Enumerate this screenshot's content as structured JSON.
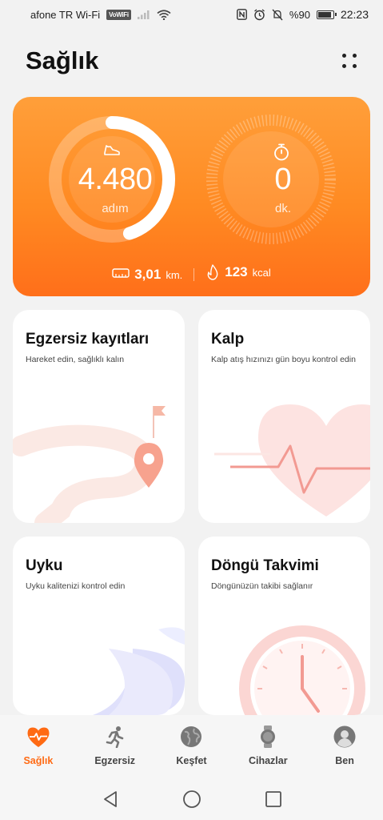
{
  "status_bar": {
    "carrier": "afone TR Wi-Fi",
    "vowifi": "VoWiFi",
    "battery_text": "%90",
    "battery_level": 0.9,
    "time": "22:23"
  },
  "header": {
    "title": "Sağlık"
  },
  "activity": {
    "steps_value": "4.480",
    "steps_unit": "adım",
    "steps_progress": 0.45,
    "minutes_value": "0",
    "minutes_unit": "dk.",
    "distance_value": "3,01",
    "distance_unit": "km.",
    "calories_value": "123",
    "calories_unit": "kcal",
    "accent_color": "#ff8a22"
  },
  "cards": {
    "exercise": {
      "title": "Egzersiz kayıtları",
      "subtitle": "Hareket edin, sağlıklı kalın"
    },
    "heart": {
      "title": "Kalp",
      "subtitle": "Kalp atış hızınızı gün boyu kontrol edin"
    },
    "sleep": {
      "title": "Uyku",
      "subtitle": "Uyku kalitenizi kontrol edin"
    },
    "cycle": {
      "title": "Döngü Takvimi",
      "subtitle": "Döngünüzün takibi sağlanır"
    }
  },
  "nav": {
    "items": [
      {
        "label": "Sağlık",
        "icon": "heart-pulse-icon",
        "active": true
      },
      {
        "label": "Egzersiz",
        "icon": "runner-icon",
        "active": false
      },
      {
        "label": "Keşfet",
        "icon": "globe-icon",
        "active": false
      },
      {
        "label": "Cihazlar",
        "icon": "watch-icon",
        "active": false
      },
      {
        "label": "Ben",
        "icon": "profile-icon",
        "active": false
      }
    ],
    "active_color": "#ff6a13"
  }
}
